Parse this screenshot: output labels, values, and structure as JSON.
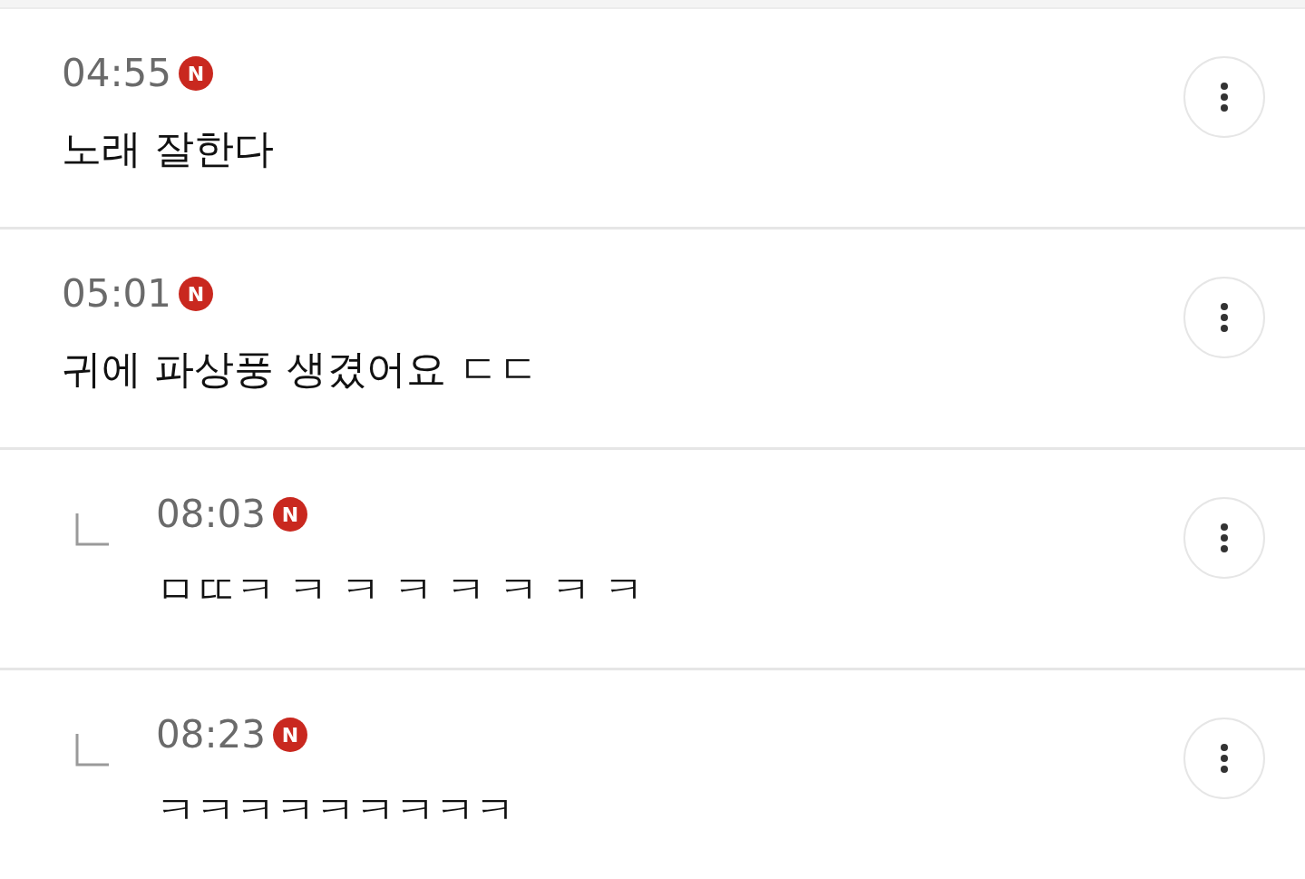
{
  "comments": [
    {
      "kind": "comment",
      "time": "04:55",
      "badge": "N",
      "text": "노래 잘한다"
    },
    {
      "kind": "comment",
      "time": "05:01",
      "badge": "N",
      "text": "귀에 파상풍 생겼어요 ㄷㄷ"
    },
    {
      "kind": "reply",
      "time": "08:03",
      "badge": "N",
      "text": "ㅁㄸㅋ ㅋ ㅋ ㅋ ㅋ ㅋ ㅋ ㅋ"
    },
    {
      "kind": "reply",
      "time": "08:23",
      "badge": "N",
      "text": "ㅋㅋㅋㅋㅋㅋㅋㅋㅋ"
    }
  ]
}
